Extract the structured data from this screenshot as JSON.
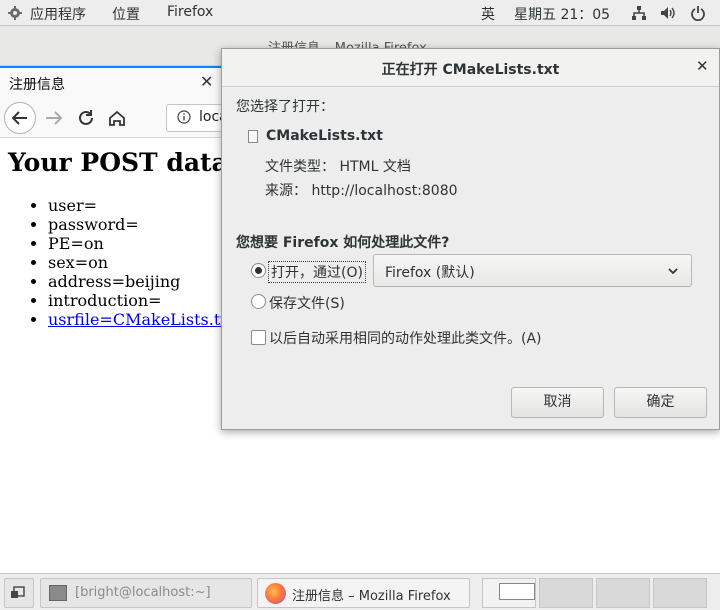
{
  "top_panel": {
    "apps_label": "应用程序",
    "places_label": "位置",
    "firefox_label": "Firefox",
    "input_method": "英",
    "clock": "星期五 21：05"
  },
  "browser": {
    "window_title": "注册信息 – Mozilla Firefox",
    "tab_label": "注册信息",
    "url_text": "localhost"
  },
  "page": {
    "heading": "Your POST data",
    "items": [
      "user=",
      "password=",
      "PE=on",
      "sex=on",
      "address=beijing",
      "introduction="
    ],
    "link_item": "usrfile=CMakeLists.txt"
  },
  "dialog": {
    "title": "正在打开 CMakeLists.txt",
    "intro": "您选择了打开：",
    "file_name": "CMakeLists.txt",
    "file_type": "文件类型： HTML 文档",
    "source": "来源： http://localhost:8080",
    "question": "您想要 Firefox 如何处理此文件?",
    "open_with_label": "打开，通过(O)",
    "app_select_value": "Firefox (默认)",
    "save_label": "保存文件(S)",
    "auto_label": "以后自动采用相同的动作处理此类文件。(A)",
    "cancel_label": "取消",
    "ok_label": "确定"
  },
  "taskbar": {
    "terminal_label": "[bright@localhost:~]",
    "firefox_label": "注册信息 – Mozilla Firefox"
  }
}
